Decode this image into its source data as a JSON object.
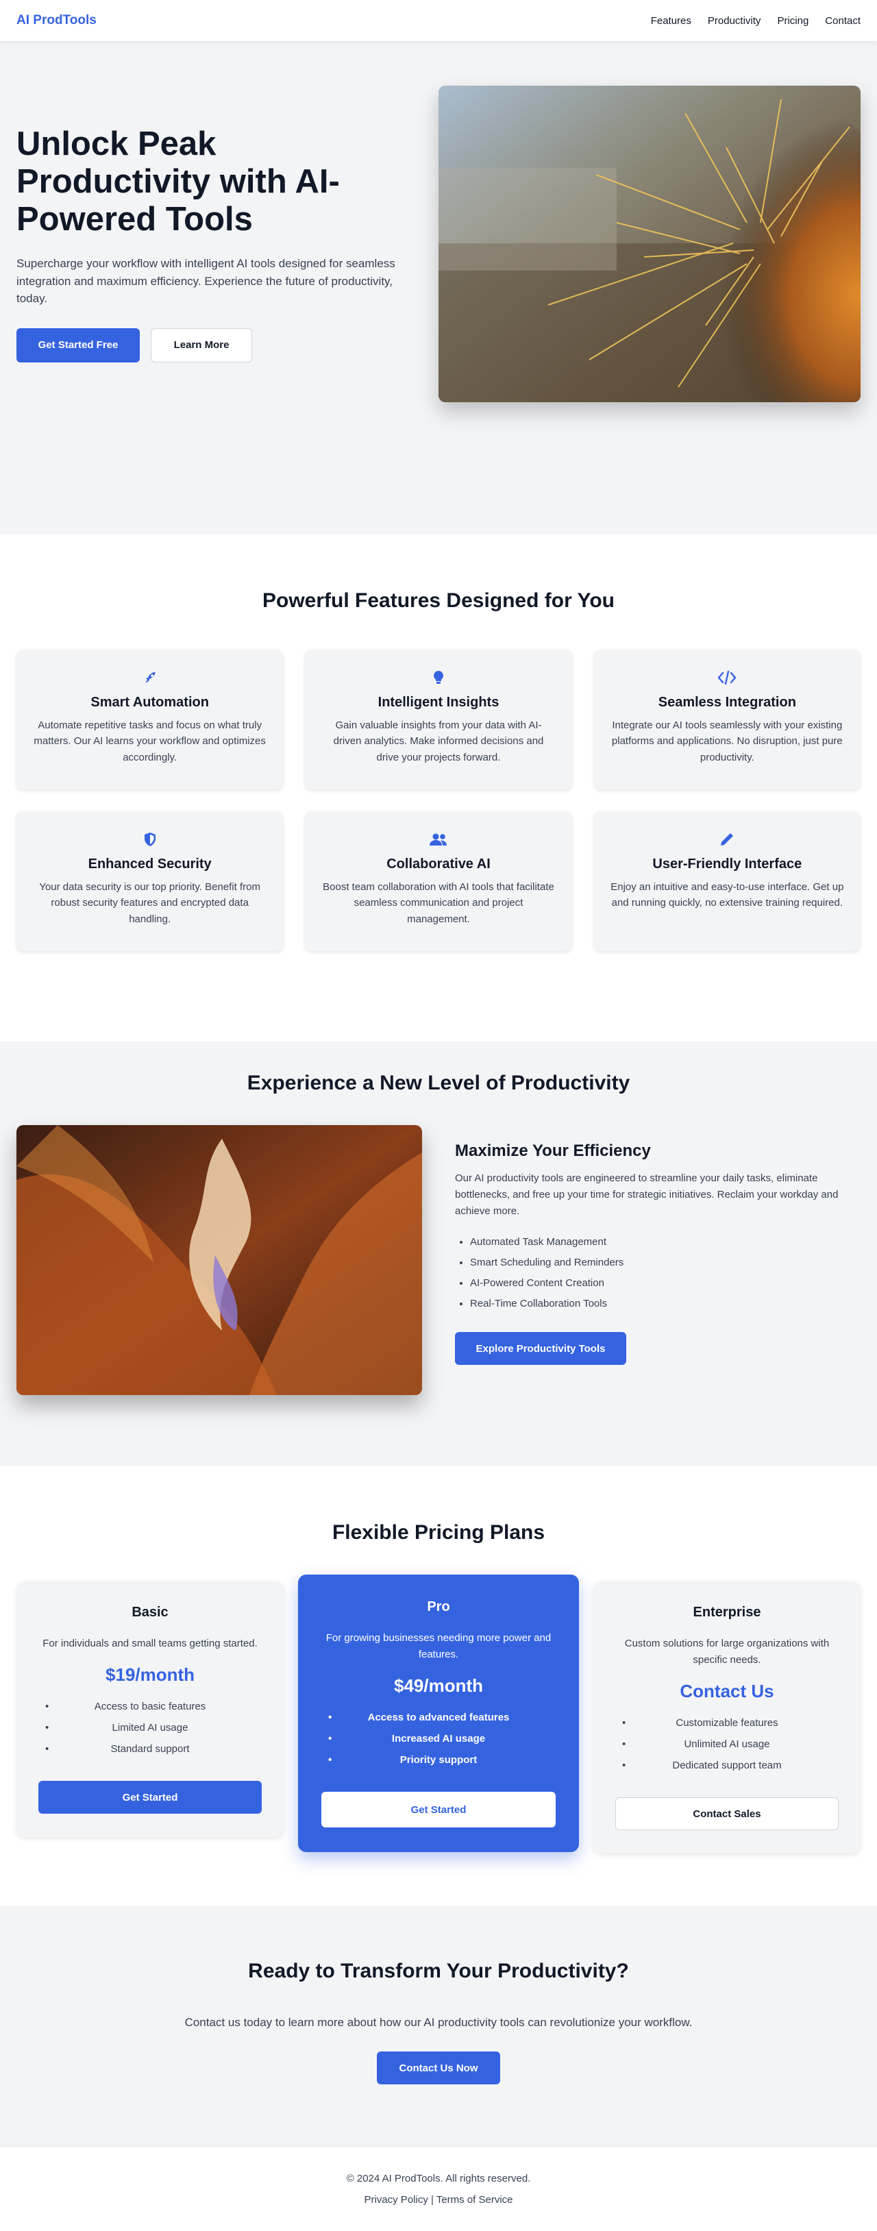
{
  "header": {
    "brand": "AI ProdTools",
    "nav": [
      "Features",
      "Productivity",
      "Pricing",
      "Contact"
    ]
  },
  "hero": {
    "title": "Unlock Peak Productivity with AI-Powered Tools",
    "subtitle": "Supercharge your workflow with intelligent AI tools designed for seamless integration and maximum efficiency. Experience the future of productivity, today.",
    "primary_cta": "Get Started Free",
    "secondary_cta": "Learn More"
  },
  "features": {
    "title": "Powerful Features Designed for You",
    "items": [
      {
        "icon": "rocket-icon",
        "title": "Smart Automation",
        "desc": "Automate repetitive tasks and focus on what truly matters. Our AI learns your workflow and optimizes accordingly."
      },
      {
        "icon": "lightbulb-icon",
        "title": "Intelligent Insights",
        "desc": "Gain valuable insights from your data with AI-driven analytics. Make informed decisions and drive your projects forward."
      },
      {
        "icon": "code-icon",
        "title": "Seamless Integration",
        "desc": "Integrate our AI tools seamlessly with your existing platforms and applications. No disruption, just pure productivity."
      },
      {
        "icon": "shield-icon",
        "title": "Enhanced Security",
        "desc": "Your data security is our top priority. Benefit from robust security features and encrypted data handling."
      },
      {
        "icon": "users-icon",
        "title": "Collaborative AI",
        "desc": "Boost team collaboration with AI tools that facilitate seamless communication and project management."
      },
      {
        "icon": "pen-icon",
        "title": "User-Friendly Interface",
        "desc": "Enjoy an intuitive and easy-to-use interface. Get up and running quickly, no extensive training required."
      }
    ]
  },
  "experience": {
    "title": "Experience a New Level of Productivity",
    "heading": "Maximize Your Efficiency",
    "desc": "Our AI productivity tools are engineered to streamline your daily tasks, eliminate bottlenecks, and free up your time for strategic initiatives. Reclaim your workday and achieve more.",
    "list": [
      "Automated Task Management",
      "Smart Scheduling and Reminders",
      "AI-Powered Content Creation",
      "Real-Time Collaboration Tools"
    ],
    "cta": "Explore Productivity Tools"
  },
  "pricing": {
    "title": "Flexible Pricing Plans",
    "plans": [
      {
        "name": "Basic",
        "desc": "For individuals and small teams getting started.",
        "price": "$19/month",
        "features": [
          "Access to basic features",
          "Limited AI usage",
          "Standard support"
        ],
        "cta": "Get Started"
      },
      {
        "name": "Pro",
        "desc": "For growing businesses needing more power and features.",
        "price": "$49/month",
        "features": [
          "Access to advanced features",
          "Increased AI usage",
          "Priority support"
        ],
        "cta": "Get Started"
      },
      {
        "name": "Enterprise",
        "desc": "Custom solutions for large organizations with specific needs.",
        "price": "Contact Us",
        "features": [
          "Customizable features",
          "Unlimited AI usage",
          "Dedicated support team"
        ],
        "cta": "Contact Sales"
      }
    ]
  },
  "cta": {
    "title": "Ready to Transform Your Productivity?",
    "desc": "Contact us today to learn more about how our AI productivity tools can revolutionize your workflow.",
    "button": "Contact Us Now"
  },
  "footer": {
    "copyright": "© 2024 AI ProdTools. All rights reserved.",
    "privacy": "Privacy Policy",
    "separator": "|",
    "terms": "Terms of Service"
  },
  "colors": {
    "accent": "#3563e0",
    "section_bg": "#f3f4f6",
    "heading": "#111827"
  }
}
